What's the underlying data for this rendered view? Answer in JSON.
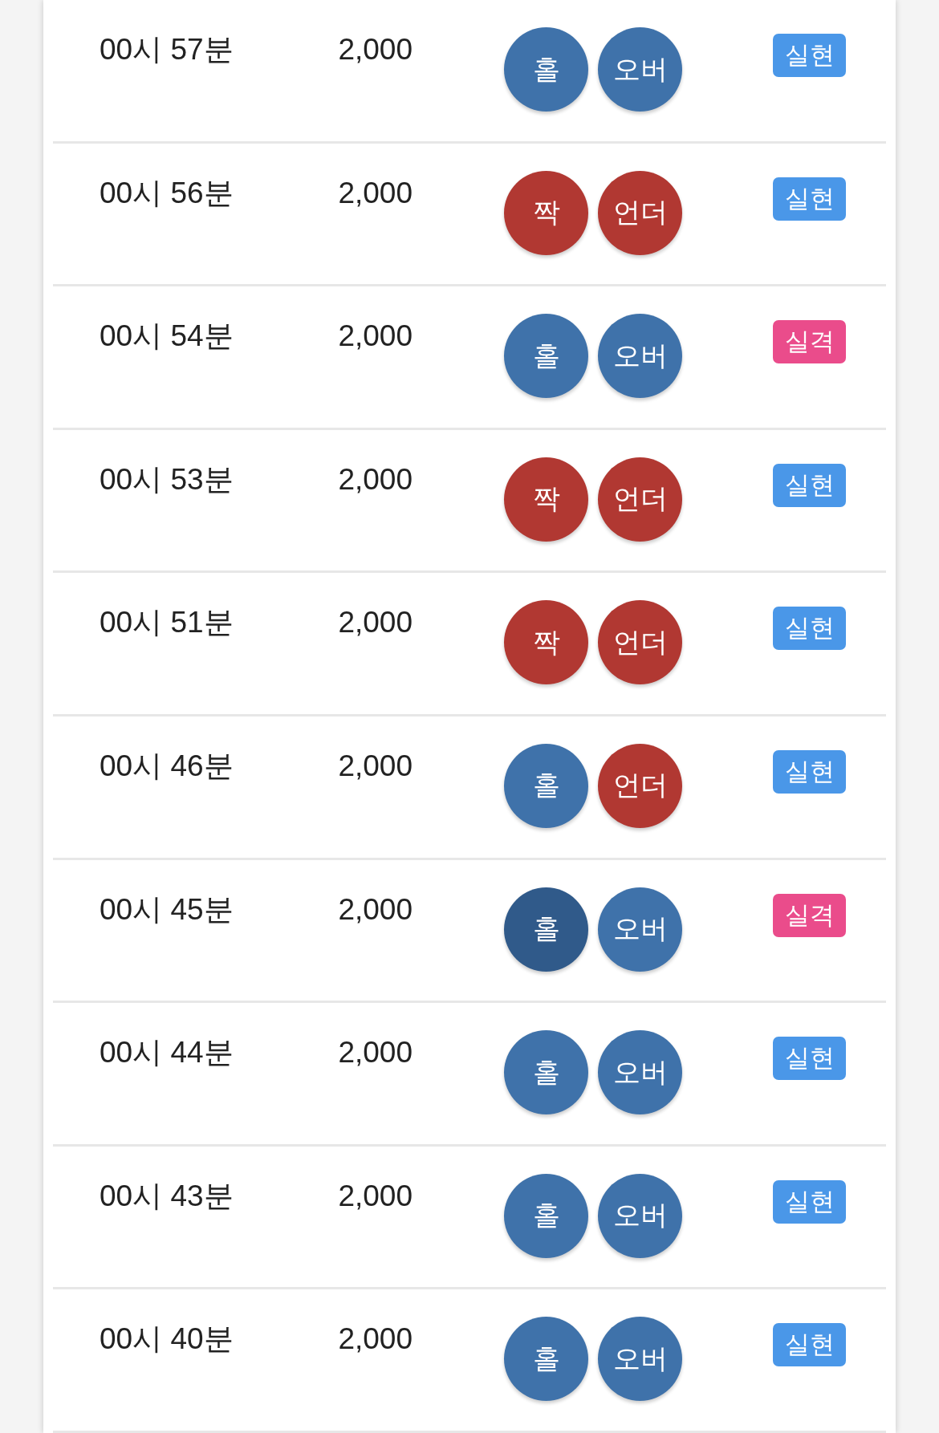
{
  "rows": [
    {
      "time": "00시 57분",
      "amount": "2,000",
      "balls": [
        {
          "label": "홀",
          "kind": "blue",
          "pressed": false
        },
        {
          "label": "오버",
          "kind": "blue",
          "pressed": false
        }
      ],
      "result": {
        "label": "실현",
        "kind": "hit"
      }
    },
    {
      "time": "00시 56분",
      "amount": "2,000",
      "balls": [
        {
          "label": "짝",
          "kind": "red",
          "pressed": false
        },
        {
          "label": "언더",
          "kind": "red",
          "pressed": false
        }
      ],
      "result": {
        "label": "실현",
        "kind": "hit"
      }
    },
    {
      "time": "00시 54분",
      "amount": "2,000",
      "balls": [
        {
          "label": "홀",
          "kind": "blue",
          "pressed": false
        },
        {
          "label": "오버",
          "kind": "blue",
          "pressed": false
        }
      ],
      "result": {
        "label": "실격",
        "kind": "miss"
      }
    },
    {
      "time": "00시 53분",
      "amount": "2,000",
      "balls": [
        {
          "label": "짝",
          "kind": "red",
          "pressed": false
        },
        {
          "label": "언더",
          "kind": "red",
          "pressed": false
        }
      ],
      "result": {
        "label": "실현",
        "kind": "hit"
      }
    },
    {
      "time": "00시 51분",
      "amount": "2,000",
      "balls": [
        {
          "label": "짝",
          "kind": "red",
          "pressed": false
        },
        {
          "label": "언더",
          "kind": "red",
          "pressed": false
        }
      ],
      "result": {
        "label": "실현",
        "kind": "hit"
      }
    },
    {
      "time": "00시 46분",
      "amount": "2,000",
      "balls": [
        {
          "label": "홀",
          "kind": "blue",
          "pressed": false
        },
        {
          "label": "언더",
          "kind": "red",
          "pressed": false
        }
      ],
      "result": {
        "label": "실현",
        "kind": "hit"
      }
    },
    {
      "time": "00시 45분",
      "amount": "2,000",
      "balls": [
        {
          "label": "홀",
          "kind": "blue",
          "pressed": true
        },
        {
          "label": "오버",
          "kind": "blue",
          "pressed": false
        }
      ],
      "result": {
        "label": "실격",
        "kind": "miss"
      }
    },
    {
      "time": "00시 44분",
      "amount": "2,000",
      "balls": [
        {
          "label": "홀",
          "kind": "blue",
          "pressed": false
        },
        {
          "label": "오버",
          "kind": "blue",
          "pressed": false
        }
      ],
      "result": {
        "label": "실현",
        "kind": "hit"
      }
    },
    {
      "time": "00시 43분",
      "amount": "2,000",
      "balls": [
        {
          "label": "홀",
          "kind": "blue",
          "pressed": false
        },
        {
          "label": "오버",
          "kind": "blue",
          "pressed": false
        }
      ],
      "result": {
        "label": "실현",
        "kind": "hit"
      }
    },
    {
      "time": "00시 40분",
      "amount": "2,000",
      "balls": [
        {
          "label": "홀",
          "kind": "blue",
          "pressed": false
        },
        {
          "label": "오버",
          "kind": "blue",
          "pressed": false
        }
      ],
      "result": {
        "label": "실현",
        "kind": "hit"
      }
    }
  ]
}
